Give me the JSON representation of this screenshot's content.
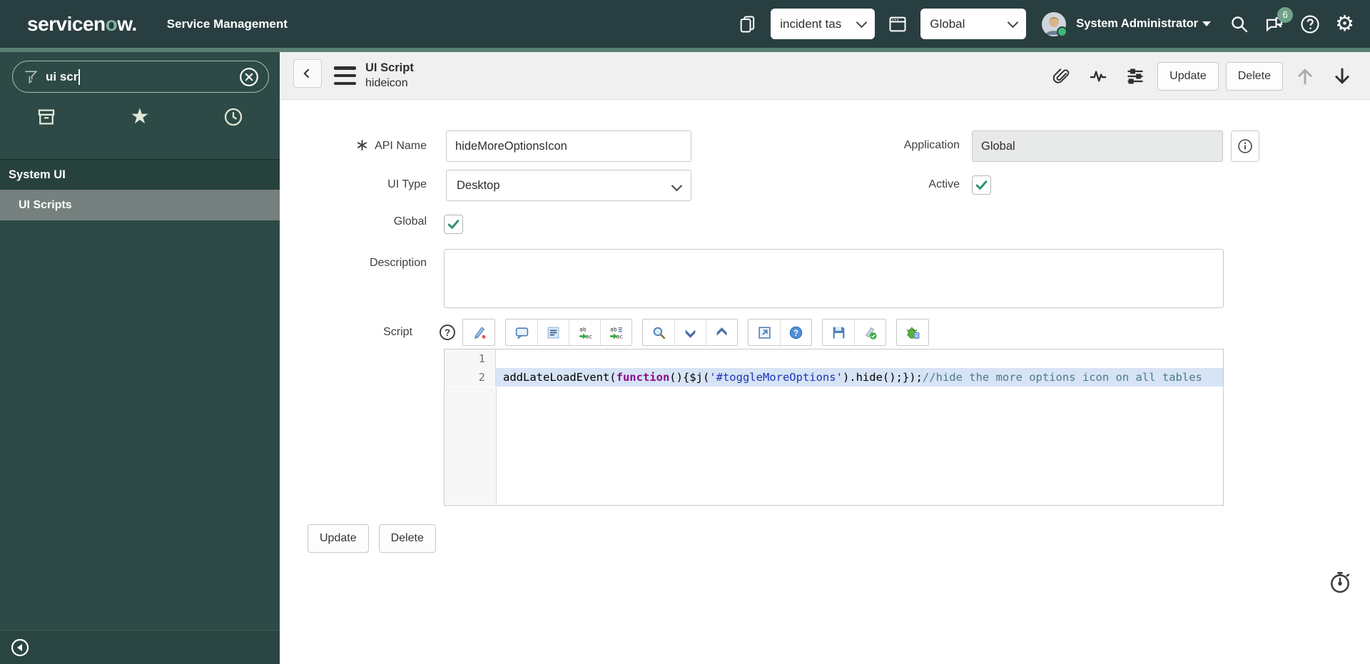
{
  "header": {
    "logo": {
      "prefix": "servicen",
      "accent_char": "o",
      "suffix": "w."
    },
    "app_label": "Service Management",
    "update_set": {
      "value": "incident tas"
    },
    "application_picker": {
      "value": "Global"
    },
    "user": {
      "name": "System Administrator"
    },
    "chat_badge": "6",
    "icon_names": [
      "copy-pages-icon",
      "app-window-icon",
      "search-icon",
      "connect-chat-icon",
      "help-icon",
      "settings-icon"
    ]
  },
  "sidebar": {
    "filter": {
      "value": "ui scr"
    },
    "tab_icon_names": [
      "all-applications-icon",
      "favorites-icon",
      "history-icon"
    ],
    "section_title": "System UI",
    "items": [
      {
        "label": "UI Scripts",
        "selected": true
      }
    ]
  },
  "form_header": {
    "title": "UI Script",
    "subtitle": "hideicon",
    "icon_names": [
      "paperclip-icon",
      "activity-stream-icon",
      "form-settings-icon",
      "previous-record-icon",
      "next-record-icon"
    ],
    "buttons": {
      "update": "Update",
      "delete": "Delete"
    }
  },
  "form": {
    "api_name": {
      "label": "API Name",
      "value": "hideMoreOptionsIcon",
      "mandatory": true
    },
    "application": {
      "label": "Application",
      "value": "Global",
      "readonly": true
    },
    "ui_type": {
      "label": "UI Type",
      "value": "Desktop"
    },
    "active": {
      "label": "Active",
      "checked": true
    },
    "global": {
      "label": "Global",
      "checked": true
    },
    "description": {
      "label": "Description",
      "value": ""
    },
    "script": {
      "label": "Script"
    },
    "buttons": {
      "update": "Update",
      "delete": "Delete"
    }
  },
  "script_editor": {
    "toolbar_icons": [
      "format-code-icon",
      "toggle-comment-icon",
      "comment-lines-icon",
      "replace-icon",
      "replace-all-icon",
      "editor-search-icon",
      "find-next-icon",
      "find-previous-icon",
      "open-in-new-window-icon",
      "editor-help-icon",
      "save-icon",
      "validate-script-icon",
      "debug-icon"
    ],
    "lines": [
      {
        "number": "1",
        "active": false,
        "tokens": []
      },
      {
        "number": "2",
        "active": true,
        "tokens": [
          {
            "text": "addLateLoadEvent(",
            "type": "plain"
          },
          {
            "text": "function",
            "type": "keyword"
          },
          {
            "text": "(){$j(",
            "type": "plain"
          },
          {
            "text": "'#toggleMoreOptions'",
            "type": "string"
          },
          {
            "text": ").hide();});",
            "type": "plain"
          },
          {
            "text": "//hide the more options icon on all tables",
            "type": "comment"
          }
        ]
      }
    ]
  },
  "colors": {
    "banner_bg": "#293e40",
    "accent_strip": "#5a7f73",
    "sidebar_bg": "#2d4a46",
    "selected_item_bg": "#76817f",
    "badge_green": "#6fa287",
    "checkmark_green": "#2b9273",
    "active_line_bg": "#d7e4f5",
    "keyword_color": "#8b0a8b",
    "string_color": "#1a34b8",
    "comment_color": "#4c7b87"
  }
}
